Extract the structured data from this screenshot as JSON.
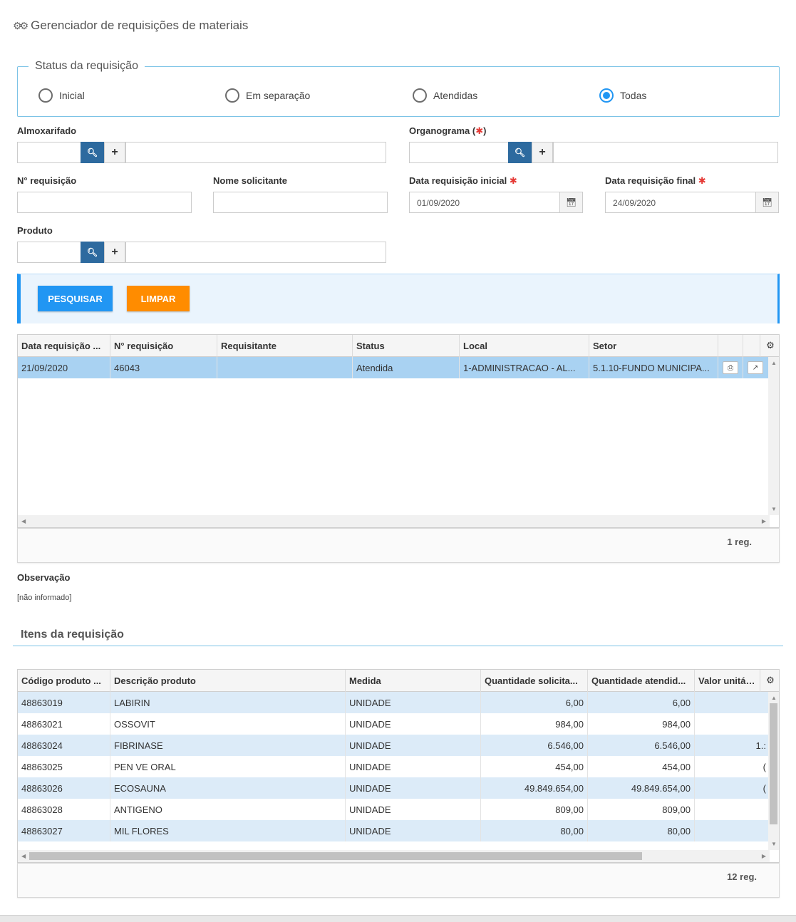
{
  "page": {
    "title": "Gerenciador de requisições de materiais"
  },
  "status": {
    "legend": "Status da requisição",
    "options": [
      {
        "label": "Inicial",
        "checked": false
      },
      {
        "label": "Em separação",
        "checked": false
      },
      {
        "label": "Atendidas",
        "checked": false
      },
      {
        "label": "Todas",
        "checked": true
      }
    ]
  },
  "filters": {
    "almoxarifado": {
      "label": "Almoxarifado"
    },
    "organograma": {
      "label": "Organograma (",
      "required_mark": "✱",
      "label_end": ")"
    },
    "num_requisicao": {
      "label": "N° requisição"
    },
    "nome_solicitante": {
      "label": "Nome solicitante"
    },
    "data_inicial": {
      "label": "Data requisição inicial",
      "required_mark": "✱",
      "value": "01/09/2020"
    },
    "data_final": {
      "label": "Data requisição final",
      "required_mark": "✱",
      "value": "24/09/2020"
    },
    "produto": {
      "label": "Produto"
    }
  },
  "actions": {
    "search_label": "PESQUISAR",
    "clear_label": "LIMPAR"
  },
  "requisicoes_grid": {
    "columns": [
      "Data requisição ...",
      "N° requisição",
      "Requisitante",
      "Status",
      "Local",
      "Setor"
    ],
    "rows": [
      [
        "21/09/2020",
        "46043",
        "",
        "Atendida",
        "1-ADMINISTRACAO - AL...",
        "5.1.10-FUNDO MUNICIPA..."
      ]
    ],
    "count": "1 reg."
  },
  "observacao": {
    "label": "Observação",
    "value": "[não informado]"
  },
  "itens": {
    "title": "Itens da requisição",
    "columns": [
      "Código produto ...",
      "Descrição produto",
      "Medida",
      "Quantidade solicita...",
      "Quantidade atendid...",
      "Valor unitário"
    ],
    "rows": [
      [
        "48863019",
        "LABIRIN",
        "UNIDADE",
        "6,00",
        "6,00",
        ""
      ],
      [
        "48863021",
        "OSSOVIT",
        "UNIDADE",
        "984,00",
        "984,00",
        ""
      ],
      [
        "48863024",
        "FIBRINASE",
        "UNIDADE",
        "6.546,00",
        "6.546,00",
        "1.:"
      ],
      [
        "48863025",
        "PEN VE ORAL",
        "UNIDADE",
        "454,00",
        "454,00",
        "("
      ],
      [
        "48863026",
        "ECOSAUNA",
        "UNIDADE",
        "49.849.654,00",
        "49.849.654,00",
        "("
      ],
      [
        "48863028",
        "ANTIGENO",
        "UNIDADE",
        "809,00",
        "809,00",
        ""
      ],
      [
        "48863027",
        "MIL FLORES",
        "UNIDADE",
        "80,00",
        "80,00",
        ""
      ]
    ],
    "count": "12 reg."
  },
  "colors": {
    "accent": "#2196f3",
    "orange": "#ff8c00",
    "selected_row": "#a9d2f2",
    "stripe": "#dcebf8",
    "border": "#7cc3e6"
  }
}
